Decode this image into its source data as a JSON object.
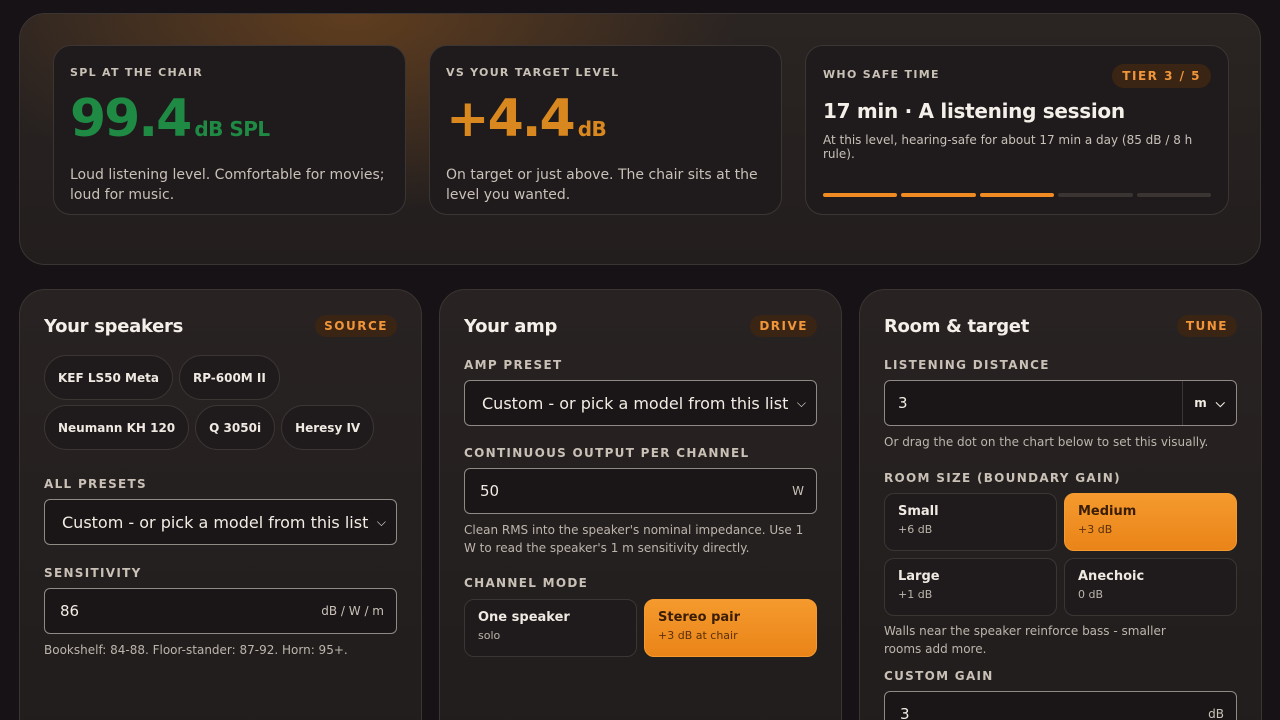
{
  "stats": {
    "spl": {
      "kicker": "SPL AT THE CHAIR",
      "value": "99.4",
      "unit": "dB SPL",
      "desc": "Loud listening level. Comfortable for movies; loud for music."
    },
    "target": {
      "kicker": "VS YOUR TARGET LEVEL",
      "value": "+4.4",
      "unit": "dB",
      "desc": "On target or just above. The chair sits at the level you wanted."
    },
    "safe": {
      "kicker": "WHO SAFE TIME",
      "tier": "TIER 3 / 5",
      "tier_active": 3,
      "tier_total": 5,
      "title": "17 min · A listening session",
      "subtitle": "At this level, hearing-safe for about 17 min a day (85 dB / 8 h rule)."
    }
  },
  "speakers": {
    "title": "Your speakers",
    "tag": "SOURCE",
    "chips": [
      "KEF LS50 Meta",
      "RP-600M II",
      "Neumann KH 120",
      "Q 3050i",
      "Heresy IV"
    ],
    "presets_label": "ALL PRESETS",
    "presets_value": "Custom - or pick a model from this list",
    "sensitivity_label": "SENSITIVITY",
    "sensitivity_value": "86",
    "sensitivity_unit": "dB / W / m",
    "sensitivity_hint": "Bookshelf: 84-88. Floor-stander: 87-92. Horn: 95+."
  },
  "amp": {
    "title": "Your amp",
    "tag": "DRIVE",
    "preset_label": "AMP PRESET",
    "preset_value": "Custom - or pick a model from this list",
    "output_label": "CONTINUOUS OUTPUT PER CHANNEL",
    "output_value": "50",
    "output_unit": "W",
    "output_hint": "Clean RMS into the speaker's nominal impedance. Use 1 W to read the speaker's 1 m sensitivity directly.",
    "channel_label": "CHANNEL MODE",
    "channel_options": [
      {
        "title": "One speaker",
        "sub": "solo"
      },
      {
        "title": "Stereo pair",
        "sub": "+3 dB at chair"
      }
    ]
  },
  "room": {
    "title": "Room & target",
    "tag": "TUNE",
    "distance_label": "LISTENING DISTANCE",
    "distance_value": "3",
    "distance_unit": "m",
    "distance_hint": "Or drag the dot on the chart below to set this visually.",
    "size_label": "ROOM SIZE (BOUNDARY GAIN)",
    "size_options": [
      {
        "title": "Small",
        "sub": "+6 dB"
      },
      {
        "title": "Medium",
        "sub": "+3 dB"
      },
      {
        "title": "Large",
        "sub": "+1 dB"
      },
      {
        "title": "Anechoic",
        "sub": "0 dB"
      }
    ],
    "size_hint": "Walls near the speaker reinforce bass - smaller rooms add more.",
    "gain_label": "CUSTOM GAIN",
    "gain_value": "3",
    "gain_unit": "dB"
  },
  "colors": {
    "accent": "#f08a22",
    "green": "#1e8a43",
    "warm": "#d9881f"
  }
}
